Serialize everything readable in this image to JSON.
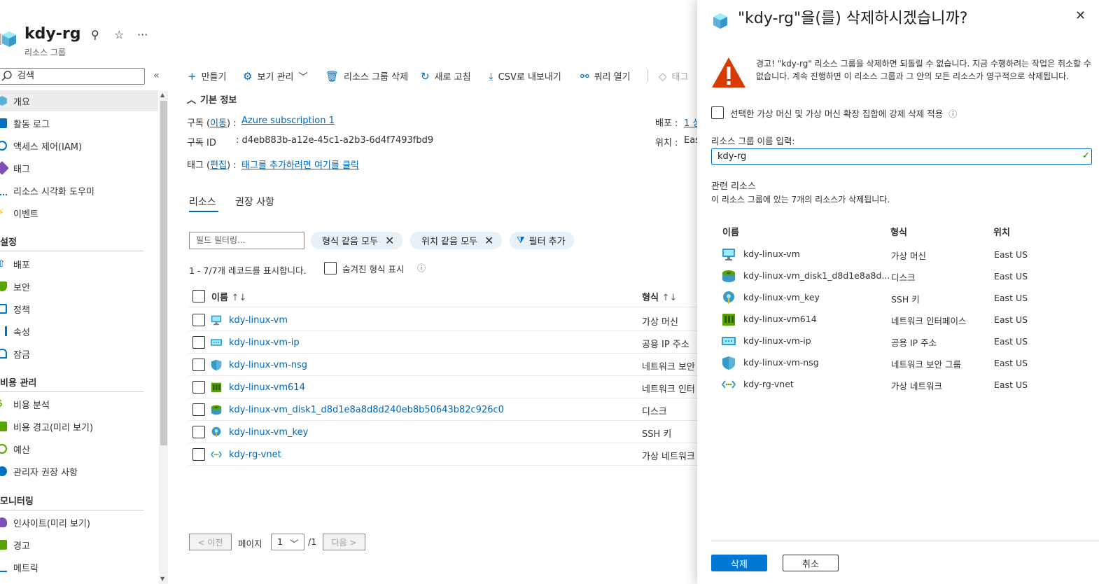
{
  "header": {
    "title": "kdy-rg",
    "subtitle": "리소스 그룹"
  },
  "sidebar": {
    "search_placeholder": "검색",
    "items": [
      {
        "label": "개요",
        "icon": "cube-icon",
        "color": "#59b4d9"
      },
      {
        "label": "활동 로그",
        "icon": "activity-log-icon",
        "color": "#0072c6"
      },
      {
        "label": "액세스 제어(IAM)",
        "icon": "iam-people-icon",
        "color": "#0072c6"
      },
      {
        "label": "태그",
        "icon": "tag-icon",
        "color": "#7b4fb5"
      },
      {
        "label": "리소스 시각화 도우미",
        "icon": "visualizer-icon",
        "color": "#0072c6"
      },
      {
        "label": "이벤트",
        "icon": "lightning-icon",
        "color": "#ffb900"
      }
    ],
    "group_settings": "설정",
    "settings_items": [
      {
        "label": "배포",
        "icon": "deploy-icon",
        "color": "#0072c6"
      },
      {
        "label": "보안",
        "icon": "security-shield-icon",
        "color": "#57a300"
      },
      {
        "label": "정책",
        "icon": "policy-icon",
        "color": "#0072c6"
      },
      {
        "label": "속성",
        "icon": "properties-icon",
        "color": "#0072c6"
      },
      {
        "label": "잠금",
        "icon": "lock-icon",
        "color": "#0072c6"
      }
    ],
    "group_cost": "비용 관리",
    "cost_items": [
      {
        "label": "비용 분석",
        "icon": "cost-analysis-icon",
        "color": "#57a300"
      },
      {
        "label": "비용 경고(미리 보기)",
        "icon": "cost-alert-icon",
        "color": "#57a300"
      },
      {
        "label": "예산",
        "icon": "budget-icon",
        "color": "#57a300"
      },
      {
        "label": "관리자 권장 사항",
        "icon": "advisor-icon",
        "color": "#0072c6"
      }
    ],
    "group_monitoring": "모니터링",
    "monitoring_items": [
      {
        "label": "인사이트(미리 보기)",
        "icon": "insights-bulb-icon",
        "color": "#7b4fb5"
      },
      {
        "label": "경고",
        "icon": "alert-icon",
        "color": "#57a300"
      },
      {
        "label": "메트릭",
        "icon": "metrics-icon",
        "color": "#0072c6"
      }
    ]
  },
  "toolbar": {
    "create": "만들기",
    "view_manage": "보기 관리",
    "delete_rg": "리소스 그룹 삭제",
    "refresh": "새로 고침",
    "export_csv": "CSV로 내보내기",
    "open_query": "쿼리 열기",
    "tags": "태그"
  },
  "essentials": {
    "heading": "기본 정보",
    "subscription_label": "구독 (",
    "subscription_move": "이동",
    "subscription_label_end": ") :",
    "subscription_value": "Azure subscription 1",
    "subscription_id_label": "구독 ID",
    "subscription_id_value": ": d4eb883b-a12e-45c1-a2b3-6d4f7493fbd9",
    "tags_label": "태그 (",
    "tags_edit": "편집",
    "tags_label_end": ") :",
    "tags_value": "태그를 추가하려면 여기를 클릭",
    "deploy_label": "배포 :",
    "deploy_value": "1 성",
    "location_label": "위치 :",
    "location_value": "Eas"
  },
  "tabs": {
    "resources": "리소스",
    "recommendations": "권장 사항"
  },
  "filters": {
    "placeholder": "필드 필터링...",
    "pill_type": "형식 같음 모두",
    "pill_location": "위치 같음 모두",
    "add_filter": "필터 추가"
  },
  "records": {
    "summary": "1 - 7/7개 레코드를 표시합니다.",
    "show_hidden": "숨겨진 형식 표시"
  },
  "table": {
    "col_name": "이름",
    "col_type": "형식",
    "rows": [
      {
        "name": "kdy-linux-vm",
        "type": "가상 머신",
        "icon": "vm-monitor-icon"
      },
      {
        "name": "kdy-linux-vm-ip",
        "type": "공용 IP 주소",
        "icon": "public-ip-icon"
      },
      {
        "name": "kdy-linux-vm-nsg",
        "type": "네트워크 보안",
        "icon": "nsg-shield-icon"
      },
      {
        "name": "kdy-linux-vm614",
        "type": "네트워크 인터",
        "icon": "nic-icon"
      },
      {
        "name": "kdy-linux-vm_disk1_d8d1e8a8d8d240eb8b50643b82c926c0",
        "type": "디스크",
        "icon": "disk-icon"
      },
      {
        "name": "kdy-linux-vm_key",
        "type": "SSH 키",
        "icon": "ssh-key-icon"
      },
      {
        "name": "kdy-rg-vnet",
        "type": "가상 네트워크",
        "icon": "vnet-icon"
      }
    ]
  },
  "paging": {
    "prev": "< 이전",
    "page_label": "페이지",
    "page_value": "1",
    "page_total": "/1",
    "next": "다음 >"
  },
  "panel": {
    "title": "\"kdy-rg\"을(를) 삭제하시겠습니까?",
    "warning": "경고! \"kdy-rg\" 리소스 그룹을 삭제하면 되돌릴 수 없습니다. 지금 수행하려는 작업은 취소할 수 없습니다. 계속 진행하면 이 리소스 그룹과 그 안의 모든 리소스가 영구적으로 삭제됩니다.",
    "force_delete_label": "선택한 가상 머신 및 가상 머신 확장 집합에 강제 삭제 적용",
    "name_input_label": "리소스 그룹 이름 입력:",
    "name_input_value": "kdy-rg",
    "related_heading": "관련 리소스",
    "related_desc": "이 리소스 그룹에 있는 7개의 리소스가 삭제됩니다.",
    "col_name": "이름",
    "col_type": "형식",
    "col_location": "위치",
    "rows": [
      {
        "name": "kdy-linux-vm",
        "type": "가상 머신",
        "location": "East US",
        "icon": "vm-monitor-icon"
      },
      {
        "name": "kdy-linux-vm_disk1_d8d1e8a8d...",
        "type": "디스크",
        "location": "East US",
        "icon": "disk-icon"
      },
      {
        "name": "kdy-linux-vm_key",
        "type": "SSH 키",
        "location": "East US",
        "icon": "ssh-key-icon"
      },
      {
        "name": "kdy-linux-vm614",
        "type": "네트워크 인터페이스",
        "location": "East US",
        "icon": "nic-icon"
      },
      {
        "name": "kdy-linux-vm-ip",
        "type": "공용 IP 주소",
        "location": "East US",
        "icon": "public-ip-icon"
      },
      {
        "name": "kdy-linux-vm-nsg",
        "type": "네트워크 보안 그룹",
        "location": "East US",
        "icon": "nsg-shield-icon"
      },
      {
        "name": "kdy-rg-vnet",
        "type": "가상 네트워크",
        "location": "East US",
        "icon": "vnet-icon"
      }
    ],
    "delete_button": "삭제",
    "cancel_button": "취소"
  },
  "colors": {
    "accent": "#0078d4",
    "link": "#0067b8",
    "warning": "#d83b01",
    "success": "#107c10"
  }
}
